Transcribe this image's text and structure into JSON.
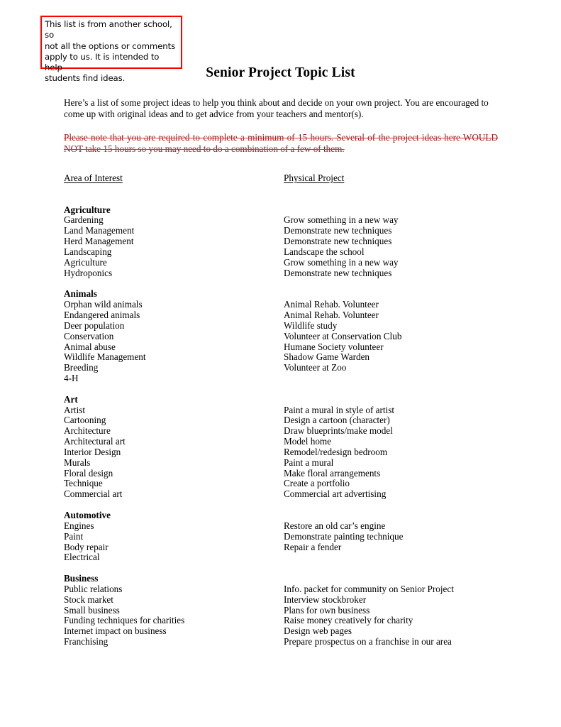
{
  "callout": {
    "lines": [
      "This list is from another school, so",
      "not all the options or comments",
      "apply to us.  It is intended to help",
      "students find ideas."
    ],
    "border_color": "#ff0000"
  },
  "document": {
    "title": "Senior Project Topic List",
    "intro": "Here’s a list of some project ideas to help you think about and decide on your own project.  You are encouraged to come up with original ideas and to get advice from your teachers and mentor(s).",
    "struck_note": "Please note that you are required to complete a minimum of 15 hours.  Several of the project ideas here WOULD NOT take 15 hours so you may need to do a combination of a few of them.",
    "struck_note_color": "#8d1c1c",
    "strike_line_color": "#e03030"
  },
  "columns": {
    "left_header": "Area of Interest",
    "right_header": "Physical Project"
  },
  "sections": [
    {
      "category": "Agriculture",
      "rows": [
        {
          "area": "Gardening",
          "project": "Grow something in a new way"
        },
        {
          "area": "Land Management",
          "project": "Demonstrate new techniques"
        },
        {
          "area": "Herd Management",
          "project": "Demonstrate new techniques"
        },
        {
          "area": "Landscaping",
          "project": "Landscape the school"
        },
        {
          "area": "Agriculture",
          "project": "Grow something in a new way"
        },
        {
          "area": "Hydroponics",
          "project": "Demonstrate new techniques"
        }
      ]
    },
    {
      "category": "Animals",
      "rows": [
        {
          "area": "Orphan wild animals",
          "project": "Animal Rehab. Volunteer"
        },
        {
          "area": "Endangered animals",
          "project": "Animal Rehab. Volunteer"
        },
        {
          "area": "Deer population",
          "project": "Wildlife study"
        },
        {
          "area": "Conservation",
          "project": "Volunteer at Conservation Club"
        },
        {
          "area": "Animal abuse",
          "project": "Humane Society volunteer"
        },
        {
          "area": "Wildlife Management",
          "project": "Shadow Game Warden"
        },
        {
          "area": "Breeding",
          "project": "Volunteer at Zoo"
        },
        {
          "area": "4-H",
          "project": ""
        }
      ]
    },
    {
      "category": "Art",
      "rows": [
        {
          "area": "Artist",
          "project": "Paint a mural in style of artist"
        },
        {
          "area": "Cartooning",
          "project": "Design a cartoon (character)"
        },
        {
          "area": "Architecture",
          "project": "Draw blueprints/make model"
        },
        {
          "area": "Architectural art",
          "project": "Model home"
        },
        {
          "area": "Interior Design",
          "project": "Remodel/redesign bedroom"
        },
        {
          "area": "Murals",
          "project": "Paint a mural"
        },
        {
          "area": "Floral design",
          "project": "Make floral arrangements"
        },
        {
          "area": "Technique",
          "project": "Create a portfolio"
        },
        {
          "area": "Commercial art",
          "project": "Commercial art advertising"
        }
      ]
    },
    {
      "category": "Automotive",
      "rows": [
        {
          "area": "Engines",
          "project": "Restore an old car’s engine"
        },
        {
          "area": "Paint",
          "project": "Demonstrate painting technique"
        },
        {
          "area": "Body repair",
          "project": "Repair a fender"
        },
        {
          "area": "Electrical",
          "project": ""
        }
      ]
    },
    {
      "category": "Business",
      "rows": [
        {
          "area": "Public relations",
          "project": "Info. packet for community on Senior Project"
        },
        {
          "area": "Stock market",
          "project": "Interview stockbroker"
        },
        {
          "area": "Small business",
          "project": "Plans for own business"
        },
        {
          "area": "Funding techniques for charities",
          "project": "Raise money creatively for charity"
        },
        {
          "area": "Internet impact on business",
          "project": "Design web pages"
        },
        {
          "area": "Franchising",
          "project": "Prepare prospectus on a franchise in our area"
        }
      ]
    }
  ]
}
